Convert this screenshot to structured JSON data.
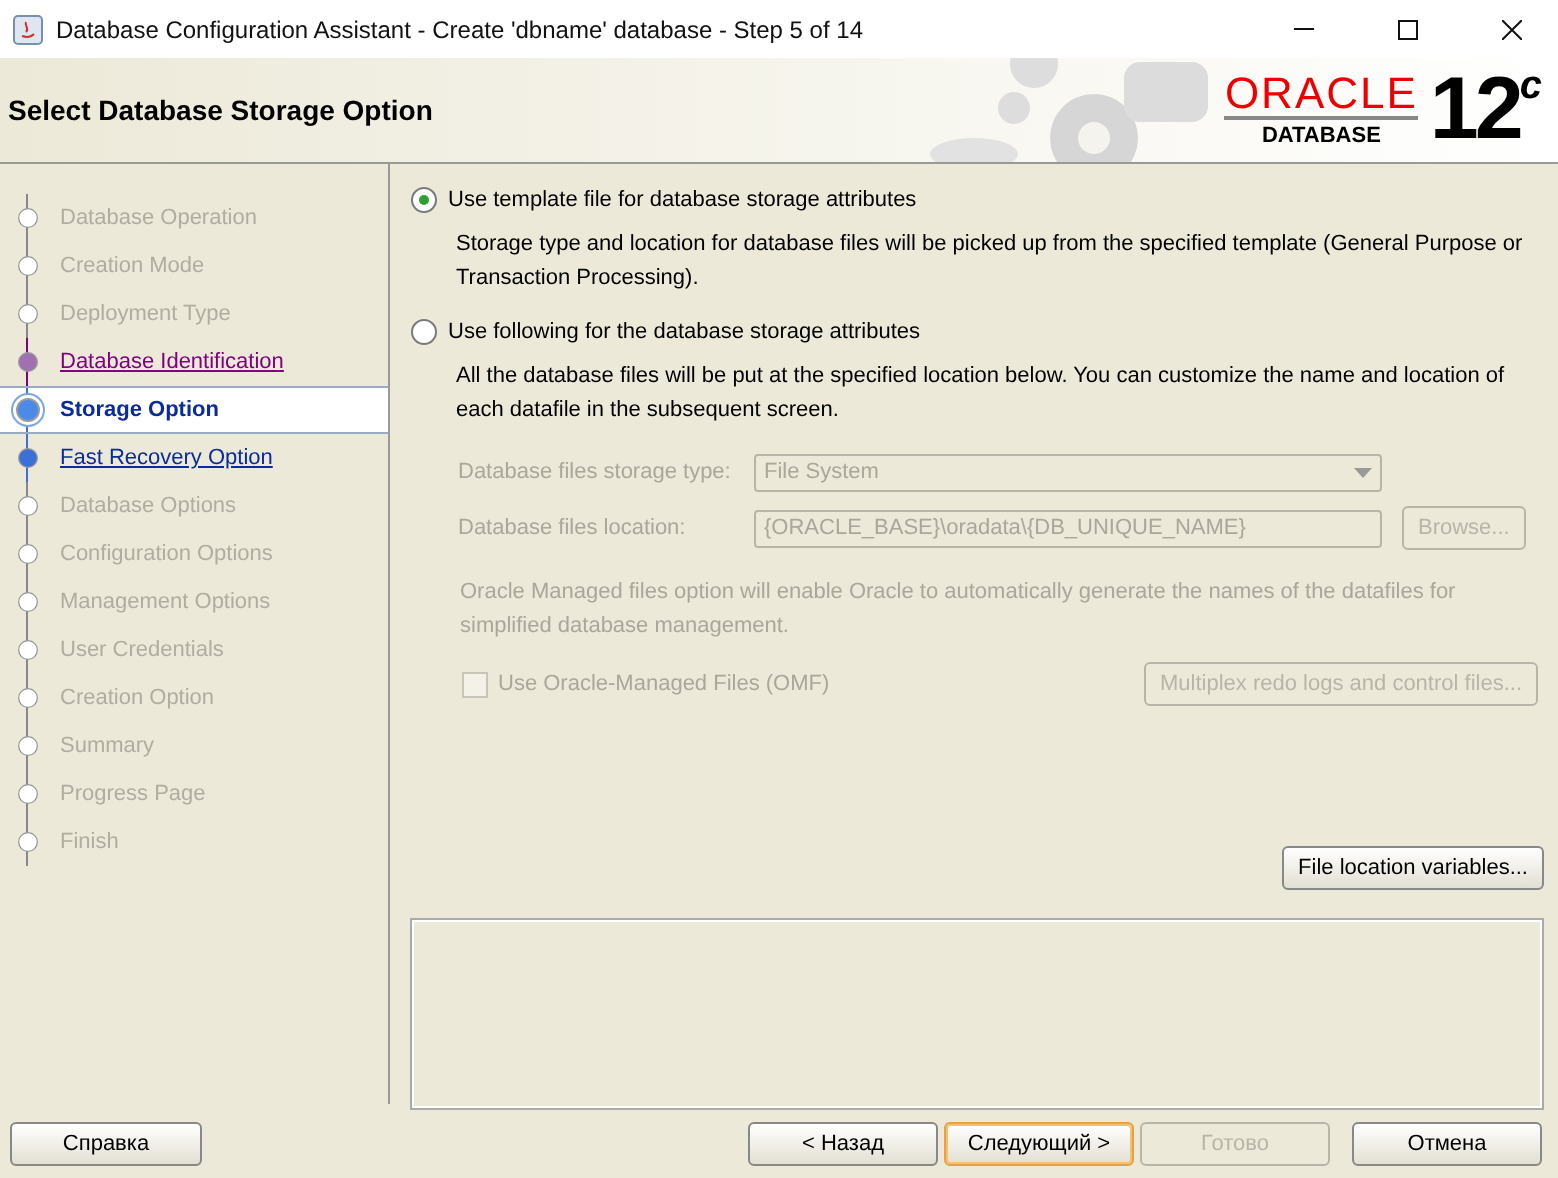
{
  "window": {
    "title": "Database Configuration Assistant - Create 'dbname' database - Step 5 of 14"
  },
  "header": {
    "title": "Select Database Storage Option",
    "brand": "ORACLE",
    "product": "DATABASE",
    "version": "12",
    "version_sup": "c"
  },
  "steps": [
    {
      "label": "Database Operation",
      "kind": "pending",
      "selected": false
    },
    {
      "label": "Creation Mode",
      "kind": "pending",
      "selected": false
    },
    {
      "label": "Deployment Type",
      "kind": "pending",
      "selected": false
    },
    {
      "label": "Database Identification",
      "kind": "visited",
      "selected": false
    },
    {
      "label": "Storage Option",
      "kind": "current",
      "selected": true
    },
    {
      "label": "Fast Recovery Option",
      "kind": "next",
      "selected": false
    },
    {
      "label": "Database Options",
      "kind": "pending",
      "selected": false
    },
    {
      "label": "Configuration Options",
      "kind": "pending",
      "selected": false
    },
    {
      "label": "Management Options",
      "kind": "pending",
      "selected": false
    },
    {
      "label": "User Credentials",
      "kind": "pending",
      "selected": false
    },
    {
      "label": "Creation Option",
      "kind": "pending",
      "selected": false
    },
    {
      "label": "Summary",
      "kind": "pending",
      "selected": false
    },
    {
      "label": "Progress Page",
      "kind": "pending",
      "selected": false
    },
    {
      "label": "Finish",
      "kind": "pending",
      "selected": false
    }
  ],
  "options": [
    {
      "label": "Use template file for database storage attributes",
      "selected": true,
      "description": "Storage type and location for database files will be picked up from the specified template (General Purpose or Transaction Processing)."
    },
    {
      "label": "Use following for the database storage attributes",
      "selected": false,
      "description": "All the database files will be put at the specified location below. You can customize the name and location of each datafile in the subsequent screen."
    }
  ],
  "storage_type": {
    "label": "Database files storage type:",
    "value": "File System",
    "disabled": true
  },
  "location": {
    "label": "Database files location:",
    "value": "{ORACLE_BASE}\\oradata\\{DB_UNIQUE_NAME}",
    "disabled": true,
    "button": "Browse..."
  },
  "omf_note": "Oracle Managed files option will enable Oracle to automatically generate the names of the datafiles for simplified database management.",
  "omf": {
    "label": "Use Oracle-Managed Files (OMF)",
    "checked": false,
    "disabled": true
  },
  "multiplex_button": {
    "label": "Multiplex redo logs and control files...",
    "disabled": true
  },
  "file_vars_button": {
    "label": "File location variables...",
    "disabled": false
  },
  "footer": {
    "help": {
      "label": "Справка",
      "disabled": false
    },
    "buttons": [
      {
        "label": "< Назад",
        "disabled": false,
        "default": false
      },
      {
        "label": "Следующий >",
        "disabled": false,
        "default": true
      },
      {
        "label": "Готово",
        "disabled": true,
        "default": false
      },
      {
        "label": "Отмена",
        "disabled": false,
        "default": false
      }
    ]
  }
}
